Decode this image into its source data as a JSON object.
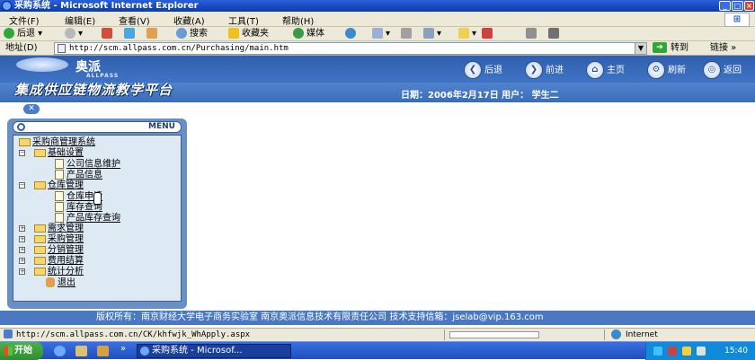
{
  "window": {
    "title": "采购系统 - Microsoft Internet Explorer"
  },
  "menubar": {
    "items": [
      "文件(F)",
      "编辑(E)",
      "查看(V)",
      "收藏(A)",
      "工具(T)",
      "帮助(H)"
    ]
  },
  "toolbar": {
    "back": "后退",
    "search": "搜索",
    "favorites": "收藏夹",
    "media": "媒体"
  },
  "address": {
    "label": "地址(D)",
    "url": "http://scm.allpass.com.cn/Purchasing/main.htm",
    "go": "转到",
    "links": "链接"
  },
  "header": {
    "logo_cn": "奥派",
    "logo_en": "ALLPASS",
    "platform_title": "集成供应链物流教学平台",
    "nav": [
      "后退",
      "前进",
      "主页",
      "刷新",
      "返回"
    ],
    "date_line": "日期：2006年2月17日  用户：  学生二"
  },
  "menu": {
    "title": "MENU",
    "root": "采购商管理系统",
    "items": [
      {
        "label": "基础设置",
        "children": [
          "公司信息维护",
          "产品信息"
        ]
      },
      {
        "label": "仓库管理",
        "children": [
          "仓库申请",
          "库存查询",
          "产品库存查询"
        ]
      },
      {
        "label": "需求管理"
      },
      {
        "label": "采购管理"
      },
      {
        "label": "分销管理"
      },
      {
        "label": "费用结算"
      },
      {
        "label": "统计分析"
      }
    ],
    "exit": "退出"
  },
  "footer": {
    "text": "版权所有：南京财经大学电子商务实验室  南京奥派信息技术有限责任公司  技术支持信箱：jselab@vip.163.com"
  },
  "status": {
    "url": "http://scm.allpass.com.cn/CK/khfwjk_WhApply.aspx",
    "zone": "Internet"
  },
  "taskbar": {
    "start": "开始",
    "task": "采购系统 - Microsof...",
    "clock": "15:40"
  }
}
